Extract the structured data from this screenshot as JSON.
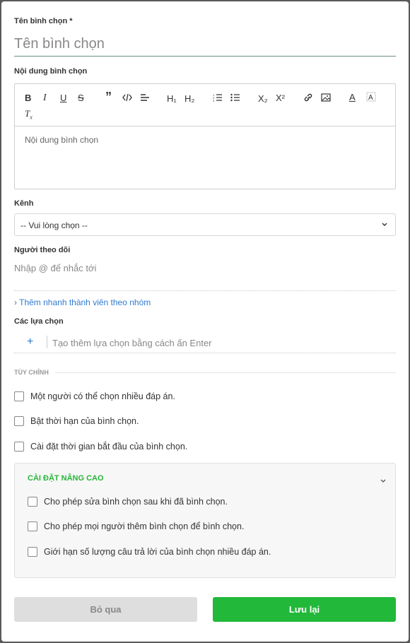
{
  "form": {
    "title_label": "Tên bình chọn *",
    "title_placeholder": "Tên bình chọn",
    "content_label": "Nội dung bình chọn",
    "content_placeholder": "Nội dung bình chọn",
    "channel_label": "Kênh",
    "channel_value": "-- Vui lòng chọn --",
    "followers_label": "Người theo dõi",
    "followers_placeholder": "Nhập @ để nhắc tới",
    "quick_add_link": "› Thêm nhanh thành viên theo nhóm",
    "choices_label": "Các lựa chọn",
    "choices_plus": "+",
    "choices_placeholder": "Tạo thêm lựa chọn bằng cách ấn Enter"
  },
  "toolbar": {
    "h1": "H₁",
    "h2": "H₂",
    "subscript": "X₂",
    "superscript": "X²"
  },
  "custom": {
    "heading": "TÙY CHỈNH",
    "options": [
      "Một người có thể chọn nhiều đáp án.",
      "Bật thời hạn của bình chọn.",
      "Cài đặt thời gian bắt đầu của bình chọn."
    ]
  },
  "advanced": {
    "title": "CÀI ĐẶT NÂNG CAO",
    "options": [
      "Cho phép sửa bình chọn sau khi đã bình chọn.",
      "Cho phép mọi người thêm bình chọn để bình chọn.",
      "Giới hạn số lượng câu trả lời của bình chọn nhiều đáp án."
    ]
  },
  "buttons": {
    "cancel": "Bỏ qua",
    "save": "Lưu lại"
  },
  "colors": {
    "accent_green": "#22b83a",
    "link_blue": "#2f7bd1"
  }
}
